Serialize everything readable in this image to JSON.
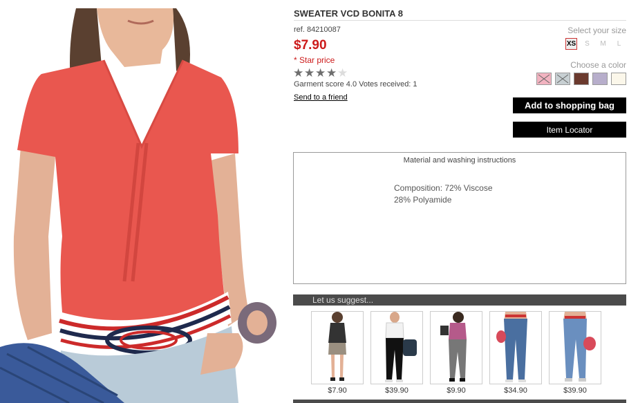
{
  "product": {
    "title": "SWEATER VCD BONITA 8",
    "ref": "ref. 84210087",
    "price": "$7.90",
    "star_price": "* Star price",
    "rating": 4,
    "rating_max": 5,
    "score_text": "Garment score 4.0 Votes received: 1",
    "send_link": "Send to a friend"
  },
  "sizes": {
    "label": "Select your size",
    "options": [
      "XS",
      "S",
      "M",
      "L"
    ],
    "selected": "XS"
  },
  "colors": {
    "label": "Choose a color",
    "swatches": [
      "#f2b3c0",
      "#c7cfd2",
      "#6b3a2e",
      "#b7aecb",
      "#fbf7ea"
    ],
    "unavailable": [
      true,
      true,
      false,
      false,
      false
    ]
  },
  "actions": {
    "add_to_bag": "Add to shopping bag",
    "item_locator": "Item Locator"
  },
  "material": {
    "title": "Material and washing instructions",
    "lines": [
      "Composition: 72% Viscose",
      "28% Polyamide"
    ]
  },
  "suggest": {
    "label": "Let us suggest...",
    "items": [
      {
        "price": "$7.90"
      },
      {
        "price": "$39.90"
      },
      {
        "price": "$9.90"
      },
      {
        "price": "$34.90"
      },
      {
        "price": "$39.90"
      }
    ]
  },
  "theme": {
    "price_color": "#cc1a1a",
    "button_color": "#000000",
    "bar_color": "#4b4b4b"
  }
}
